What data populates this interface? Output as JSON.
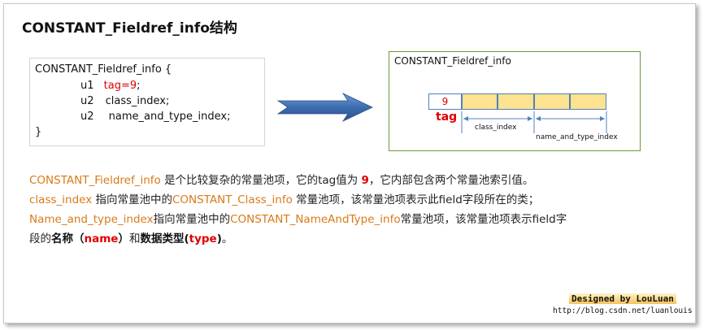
{
  "title": "CONSTANT_Fieldref_info结构",
  "code": {
    "line1": "CONSTANT_Fieldref_info {",
    "line2_type": "u1",
    "line2_field": "tag=9",
    "line2_end": ";",
    "line3_type": "u2",
    "line3_field": "class_index;",
    "line4_type": "u2",
    "line4_field": "name_and_type_index;",
    "line5": "}"
  },
  "diagram": {
    "title": "CONSTANT_Fieldref_info",
    "tag_value": "9",
    "tag_label": "tag",
    "class_index_label": "class_index",
    "name_and_type_index_label": "name_and_type_index",
    "cell_fill": "#fde28f",
    "cell_border": "#4f81bd"
  },
  "description": {
    "p1_a": "CONSTANT_Fieldref_info",
    "p1_b": " 是个比较复杂的常量池项，它的tag值为 ",
    "p1_c": "9",
    "p1_d": "，它内部包含两个常量池索引值。",
    "p2_a": "class_index",
    "p2_b": " 指向常量池中的",
    "p2_c": "CONSTANT_Class_info",
    "p2_d": " 常量池项，该常量池项表示此field字段所在的类；",
    "p3_a": "Name_and_type_index",
    "p3_b": "指向常量池中的",
    "p3_c": "CONSTANT_NameAndType_info",
    "p3_d": "常量池项，该常量池项表示field字",
    "p4_a": "段的",
    "p4_b": "名称（",
    "p4_c": "name",
    "p4_d": "）",
    "p4_e": "和",
    "p4_f": "数据类型(",
    "p4_g": "type",
    "p4_h": ")",
    "p4_i": "。"
  },
  "credit": {
    "designed_by": "Designed by LouLuan",
    "url": "http://blog.csdn.net/luanlouis"
  },
  "colors": {
    "orange": "#d97a18",
    "red": "#e00000",
    "arrow_blue": "#3d6db0",
    "box_green": "#6a9a3a"
  }
}
